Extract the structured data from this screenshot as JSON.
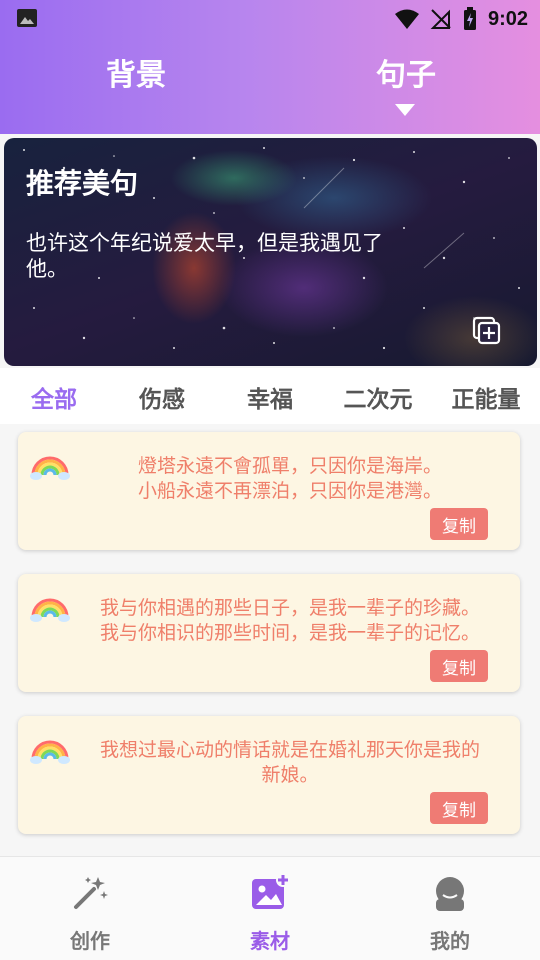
{
  "status": {
    "time": "9:02"
  },
  "top_tabs": [
    {
      "label": "背景"
    },
    {
      "label": "句子"
    }
  ],
  "banner": {
    "title": "推荐美句",
    "text": "也许这个年纪说爱太早，但是我遇见了他。",
    "add_icon": "add-collection-icon"
  },
  "categories": [
    {
      "label": "全部",
      "active": true
    },
    {
      "label": "伤感"
    },
    {
      "label": "幸福"
    },
    {
      "label": "二次元"
    },
    {
      "label": "正能量"
    }
  ],
  "cards": [
    {
      "line1": "燈塔永遠不會孤單，只因你是海岸。",
      "line2": "小船永遠不再漂泊，只因你是港灣。",
      "copy_label": "复制",
      "icon": "rainbow-icon"
    },
    {
      "line1": "我与你相遇的那些日子，是我一辈子的珍藏。",
      "line2": "我与你相识的那些时间，是我一辈子的记忆。",
      "copy_label": "复制",
      "icon": "rainbow-icon"
    },
    {
      "line1": "我想过最心动的情话就是在婚礼那天你是我的",
      "line2": "新娘。",
      "copy_label": "复制",
      "icon": "rainbow-icon"
    }
  ],
  "bottom_nav": [
    {
      "label": "创作",
      "icon": "magic-wand-icon"
    },
    {
      "label": "素材",
      "icon": "image-add-icon",
      "active": true
    },
    {
      "label": "我的",
      "icon": "user-avatar-icon"
    }
  ],
  "colors": {
    "accent": "#9a6cf0",
    "card_bg": "#fdf6e3",
    "card_text": "#ef7f6a",
    "copy_button": "#ef7b74"
  }
}
